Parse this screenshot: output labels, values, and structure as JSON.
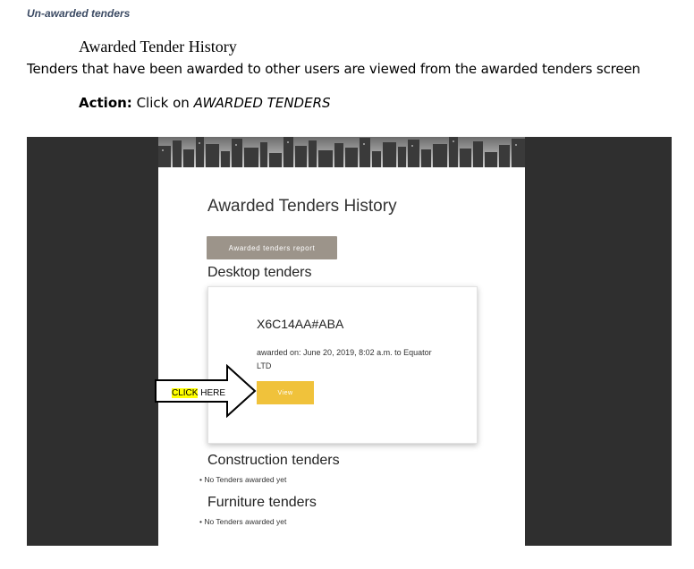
{
  "document": {
    "section_label": "Un-awarded tenders",
    "heading": "Awarded Tender History",
    "intro": "Tenders that have been awarded to other users are viewed from the awarded tenders screen",
    "action_label": "Action:",
    "action_prefix": "Click on",
    "action_target": "AWARDED TENDERS"
  },
  "app": {
    "page_title": "Awarded Tenders History",
    "report_button": "Awarded tenders report",
    "sections": {
      "desktop": {
        "title": "Desktop tenders",
        "tender": {
          "code": "X6C14AA#ABA",
          "description": "awarded on: June 20, 2019, 8:02 a.m. to Equator LTD",
          "view_button": "View"
        }
      },
      "construction": {
        "title": "Construction tenders",
        "empty": "No Tenders awarded yet"
      },
      "furniture": {
        "title": "Furniture tenders",
        "empty": "No Tenders awarded yet"
      }
    }
  },
  "callout": {
    "highlight_word": "CLICK",
    "rest": "HERE",
    "icon": "right-arrow-icon"
  },
  "colors": {
    "view_button": "#f0c23b",
    "report_button": "#9c948a",
    "figure_background": "#2f2f2f",
    "highlight": "#ffff00"
  }
}
